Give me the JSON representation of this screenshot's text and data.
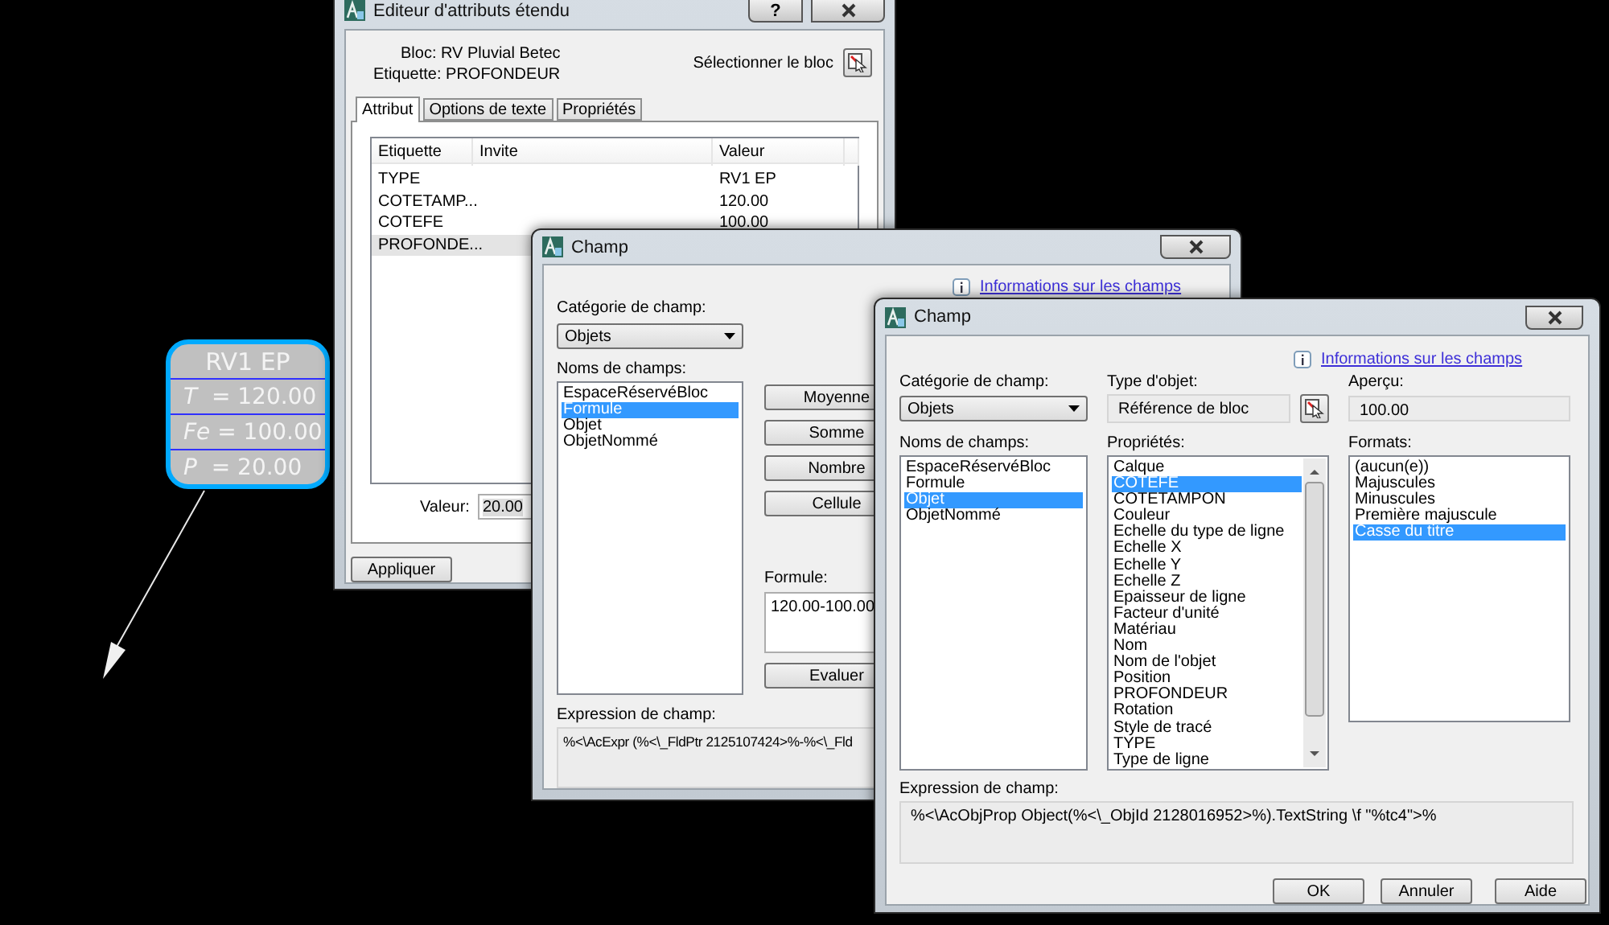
{
  "block": {
    "title": "RV1 EP",
    "rows": [
      {
        "text": "*T*  = 120.00"
      },
      {
        "text": "*Fe* = 100.00"
      },
      {
        "text": "*P*  = 20.00"
      }
    ]
  },
  "attribute_editor": {
    "title": "Editeur d'attributs étendu",
    "help_button": "?",
    "block_label": "Bloc: RV Pluvial Betec",
    "tag_label": "Etiquette: PROFONDEUR",
    "select_block_label": "Sélectionner le bloc",
    "tabs": [
      {
        "label": "Attribut",
        "selected": true
      },
      {
        "label": "Options de texte",
        "selected": false
      },
      {
        "label": "Propriétés",
        "selected": false
      }
    ],
    "table": {
      "columns": [
        "Etiquette",
        "Invite",
        "Valeur"
      ],
      "rows": [
        {
          "tag": "TYPE",
          "value": "RV1 EP",
          "selected": false
        },
        {
          "tag": "COTETAMP...",
          "value": "120.00",
          "selected": false
        },
        {
          "tag": "COTEFE",
          "value": "100.00",
          "selected": false
        },
        {
          "tag": "PROFONDE...",
          "selected": true
        }
      ]
    },
    "value_label": "Valeur:",
    "value": "20.00",
    "buttons": [
      "Appliquer"
    ]
  },
  "back_dialog": {
    "title": "Champ",
    "info_link": "Informations sur les champs",
    "category_label": "Catégorie de champ:",
    "category": "Objets",
    "names_label": "Noms de champs:",
    "names": [
      {
        "label": "EspaceRéservéBloc",
        "selected": false
      },
      {
        "label": "Formule",
        "selected": true
      },
      {
        "label": "Objet",
        "selected": false
      },
      {
        "label": "ObjetNommé",
        "selected": false
      }
    ],
    "functions": [
      "Moyenne",
      "Somme",
      "Nombre",
      "Cellule"
    ],
    "formula_label": "Formule:",
    "formula": "120.00-100.00",
    "evaluate_button": "Evaluer",
    "expression_label": "Expression de champ:",
    "expression": "%<\\AcExpr (%<\\_FldPtr 2125107424>%-%<\\_Fld"
  },
  "front_dialog": {
    "title": "Champ",
    "info_link": "Informations sur les champs",
    "category_label": "Catégorie de champ:",
    "category": "Objets",
    "object_type_label": "Type d'objet:",
    "object_type": "Référence de bloc",
    "preview_label": "Aperçu:",
    "preview": "100.00",
    "names_label": "Noms de champs:",
    "names": [
      {
        "label": "EspaceRéservéBloc",
        "selected": false
      },
      {
        "label": "Formule",
        "selected": false
      },
      {
        "label": "Objet",
        "selected": true
      },
      {
        "label": "ObjetNommé",
        "selected": false
      }
    ],
    "properties_label": "Propriétés:",
    "properties": [
      {
        "label": "Calque",
        "selected": false
      },
      {
        "label": "COTEFE",
        "selected": true
      },
      {
        "label": "COTETAMPON",
        "selected": false
      },
      {
        "label": "Couleur",
        "selected": false
      },
      {
        "label": "Echelle du type de ligne",
        "selected": false
      },
      {
        "label": "Echelle X",
        "selected": false
      },
      {
        "label": "Echelle Y",
        "selected": false
      },
      {
        "label": "Echelle Z",
        "selected": false
      },
      {
        "label": "Epaisseur de ligne",
        "selected": false
      },
      {
        "label": "Facteur d'unité",
        "selected": false
      },
      {
        "label": "Matériau",
        "selected": false
      },
      {
        "label": "Nom",
        "selected": false
      },
      {
        "label": "Nom de l'objet",
        "selected": false
      },
      {
        "label": "Position",
        "selected": false
      },
      {
        "label": "PROFONDEUR",
        "selected": false
      },
      {
        "label": "Rotation",
        "selected": false
      },
      {
        "label": "Style de tracé",
        "selected": false
      },
      {
        "label": "TYPE",
        "selected": false
      },
      {
        "label": "Type de ligne",
        "selected": false
      }
    ],
    "formats_label": "Formats:",
    "formats": [
      {
        "label": "(aucun(e))",
        "selected": false
      },
      {
        "label": "Majuscules",
        "selected": false
      },
      {
        "label": "Minuscules",
        "selected": false
      },
      {
        "label": "Première majuscule",
        "selected": false
      },
      {
        "label": "Casse du titre",
        "selected": true
      }
    ],
    "expression_label": "Expression de champ:",
    "expression": "%<\\AcObjProp Object(%<\\_ObjId 2128016952>%).TextString \\f \"%tc4\">%",
    "buttons": [
      "OK",
      "Annuler",
      "Aide"
    ]
  }
}
